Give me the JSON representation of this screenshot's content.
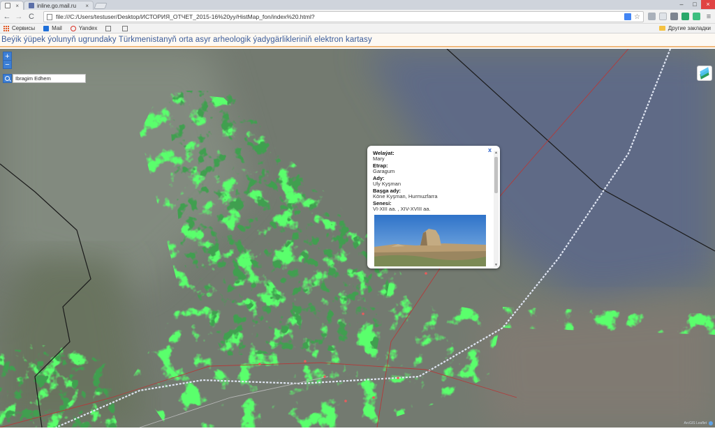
{
  "browser": {
    "tabs": [
      {
        "title": "inline.go.mail.ru",
        "close": "×"
      }
    ],
    "nav": {
      "back": "←",
      "forward": "→",
      "reload": "C"
    },
    "url": "file:///C:/Users/testuser/Desktop/ИСТОРИЯ_ОТЧЕТ_2015-16%20yy/HistMap_fon/index%20.html?",
    "star": "☆",
    "window_controls": {
      "minimize": "–",
      "maximize": "□",
      "close": "×"
    },
    "bookmarks": [
      "Сервисы",
      "Mail",
      "Yandex"
    ],
    "other_bookmarks": "Другие закладки",
    "colors": {
      "bookmark_mail": "#1e6fd9",
      "bookmark_yandex": "#d93025"
    }
  },
  "site": {
    "title": "Beýik ýüpek ýolunyň ugrundaky Türkmenistanyň orta asyr arheologik ýadygärlikleriniň elektron kartasy",
    "accent_color": "#f0b87a"
  },
  "map": {
    "controls": {
      "zoom_in": "+",
      "zoom_out": "−"
    },
    "search_value": "Ibragim Edhem",
    "layers_icon": "layers-icon",
    "attribution": "ArcGIS Leaflet",
    "popup": {
      "close": "x",
      "fields": [
        {
          "label": "Welaýat:",
          "value": "Mary"
        },
        {
          "label": "Etrap:",
          "value": "Garagum"
        },
        {
          "label": "Ady:",
          "value": "Uly Kyşman"
        },
        {
          "label": "Başga ady:",
          "value": "Köne Kyşman, Hurmuzfarra"
        },
        {
          "label": "Senesi:",
          "value": "VI-XIII aa. , XIV-XVIII aa."
        }
      ]
    }
  }
}
